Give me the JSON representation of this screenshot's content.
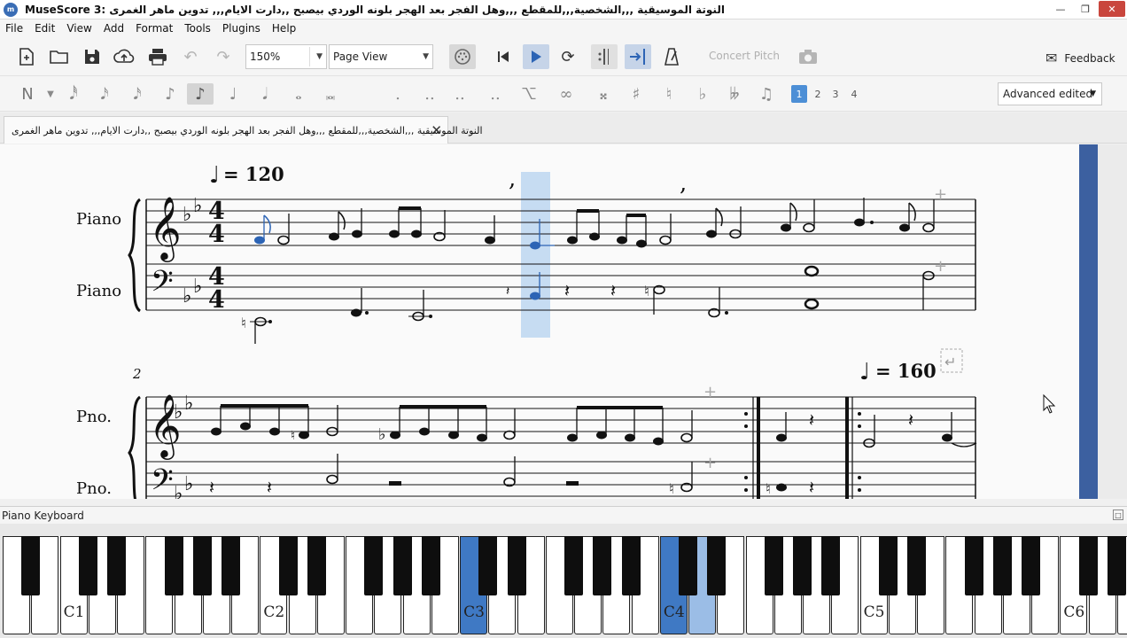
{
  "window": {
    "title": "MuseScore 3: النوتة الموسيقية ,,,الشخصية,,,للمقطع ,,,وهل الفجر بعد الهجر بلونه الوردي بيصبح ,,دارت الايام,,, تدوين ماهر الغمرى",
    "icon": "musescore-logo"
  },
  "menu": [
    "File",
    "Edit",
    "View",
    "Add",
    "Format",
    "Tools",
    "Plugins",
    "Help"
  ],
  "toolbar": {
    "zoom": "150%",
    "view_mode": "Page View",
    "concert_pitch": "Concert Pitch",
    "feedback": "Feedback"
  },
  "note_input": {
    "workspace": "Advanced edited",
    "voices": [
      "1",
      "2",
      "3",
      "4"
    ],
    "active_voice": "1"
  },
  "tabs": [
    {
      "label": "النوتة الموسيقية ,,,الشخصية,,,للمقطع ,,,وهل الفجر بعد الهجر بلونه الوردي بيصبح ,,دارت الايام,,, تدوين ماهر الغمرى"
    }
  ],
  "score": {
    "system1": {
      "tempo": "= 120",
      "treble_instrument": "Piano",
      "bass_instrument": "Piano",
      "time_signature": "4/4"
    },
    "system2": {
      "measure_number": "2",
      "tempo": "= 160",
      "treble_instrument": "Pno.",
      "bass_instrument": "Pno."
    }
  },
  "piano_keyboard": {
    "title": "Piano Keyboard",
    "labels": [
      "C1",
      "C2",
      "C3",
      "C4",
      "C5",
      "C6"
    ],
    "selected_keys": [
      "C3",
      "C4"
    ],
    "highlight_color": "#3f79c4",
    "secondary_highlight_color": "#9bbde6"
  }
}
